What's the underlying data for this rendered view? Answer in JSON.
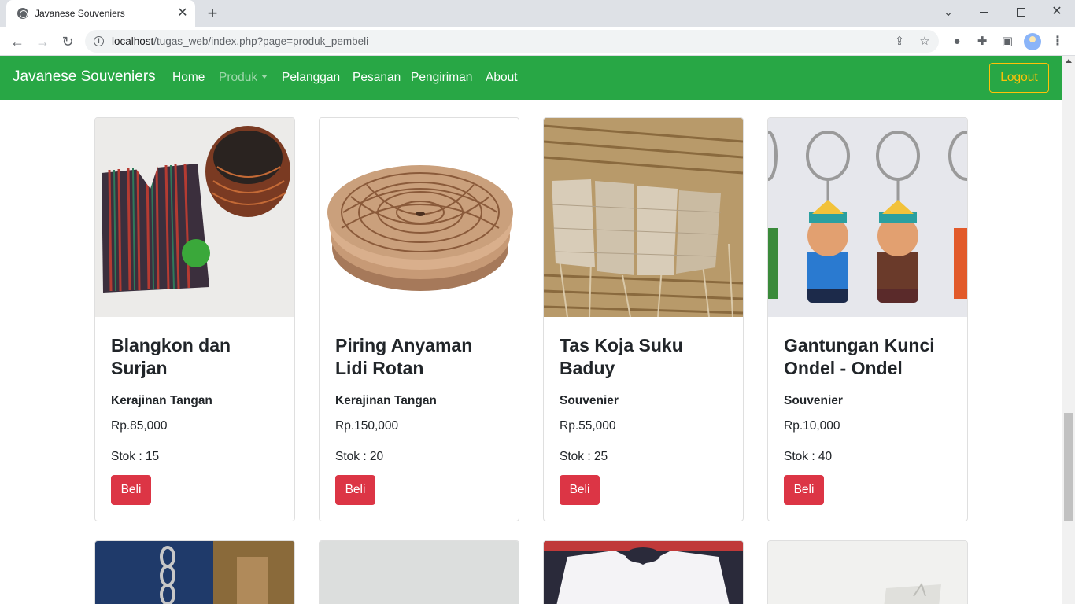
{
  "browser": {
    "tab_title": "Javanese Souveniers",
    "url_host": "localhost",
    "url_path": "/tugas_web/index.php?page=produk_pembeli"
  },
  "navbar": {
    "brand": "Javanese Souveniers",
    "links": [
      "Home",
      "Produk",
      "Pelanggan",
      "Pesanan",
      "Pengiriman",
      "About"
    ],
    "logout_label": "Logout"
  },
  "products": [
    {
      "name": "Blangkon dan Surjan",
      "category": "Kerajinan Tangan",
      "price": "Rp.85,000",
      "stock": "Stok : 15",
      "buy_label": "Beli"
    },
    {
      "name": "Piring Anyaman Lidi Rotan",
      "category": "Kerajinan Tangan",
      "price": "Rp.150,000",
      "stock": "Stok : 20",
      "buy_label": "Beli"
    },
    {
      "name": "Tas Koja Suku Baduy",
      "category": "Souvenier",
      "price": "Rp.55,000",
      "stock": "Stok : 25",
      "buy_label": "Beli"
    },
    {
      "name": "Gantungan Kunci Ondel - Ondel",
      "category": "Souvenier",
      "price": "Rp.10,000",
      "stock": "Stok : 40",
      "buy_label": "Beli"
    }
  ],
  "colors": {
    "navbar": "#28a745",
    "buy_button": "#dc3545",
    "logout_outline": "#ffc107"
  }
}
